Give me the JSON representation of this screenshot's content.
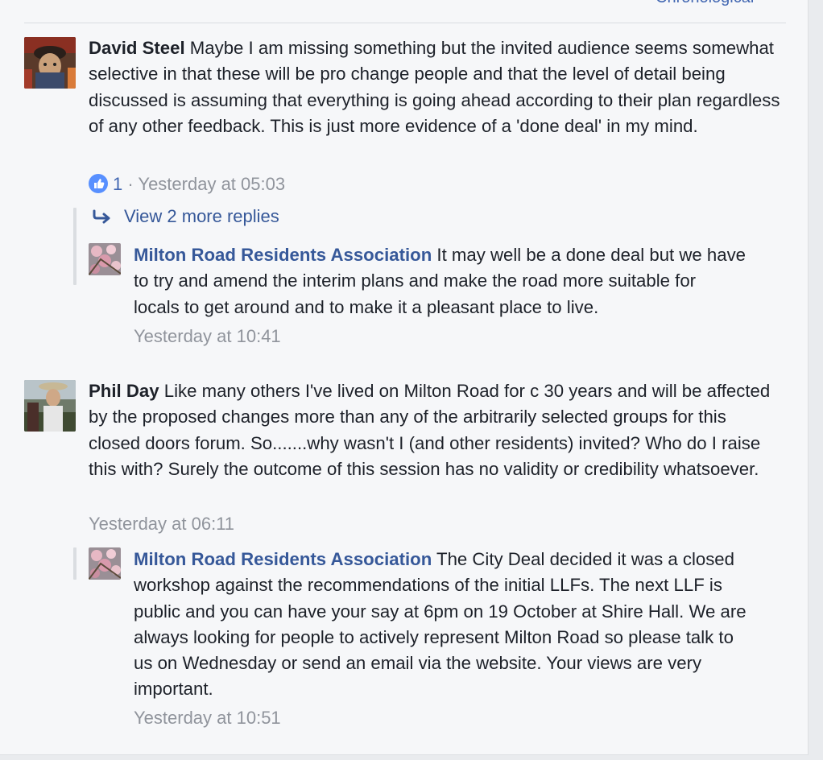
{
  "header": {
    "order_label": "Chronological"
  },
  "comments": [
    {
      "author": "David Steel",
      "text": "Maybe I am missing something but the invited audience seems somewhat selective in that these will be pro change people and that the level of detail being discussed is assuming that everything is going ahead according to their plan regardless of any other feedback. This is just more evidence of a 'done deal' in my mind.",
      "likes": "1",
      "sep": "·",
      "time": "Yesterday at 05:03",
      "more_replies": "View 2 more replies",
      "reply": {
        "author": "Milton Road Residents Association",
        "text": "It may well be a done deal but we have to try and amend the interim plans and make the road more suitable for locals to get around and to make it a pleasant place to live.",
        "time": "Yesterday at 10:41"
      }
    },
    {
      "author": "Phil Day",
      "text": "Like many others I've lived on Milton Road for c 30 years and will be affected by the proposed changes more than any of the arbitrarily selected groups for this closed doors forum. So.......why wasn't I (and other residents) invited? Who do I raise this with? Surely the outcome of this session has no validity or credibility whatsoever.",
      "time": "Yesterday at 06:11",
      "reply": {
        "author": "Milton Road Residents Association",
        "text": "The City Deal decided it was a closed workshop against the recommendations of the initial LLFs. The next LLF is public and you can have your say at 6pm on 19 October at Shire Hall. We are always looking for people to actively represent Milton Road so please talk to us on Wednesday or send an email via the website. Your views are very important.",
        "time": "Yesterday at 10:51"
      }
    }
  ],
  "colors": {
    "link": "#365899",
    "meta": "#90949c",
    "like": "#5890ff"
  }
}
